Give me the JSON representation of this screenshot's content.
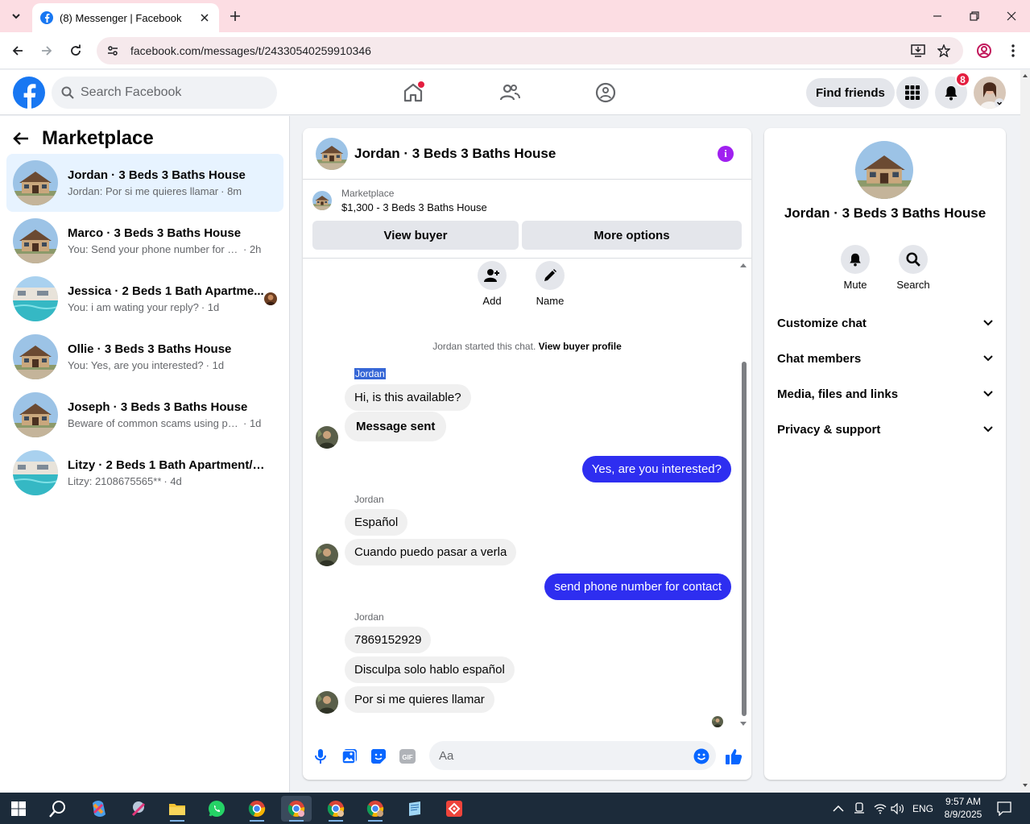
{
  "browser": {
    "tab_title": "(8) Messenger | Facebook",
    "url": "facebook.com/messages/t/24330540259910346"
  },
  "fbnav": {
    "search_placeholder": "Search Facebook",
    "find_friends": "Find friends",
    "notification_count": "8"
  },
  "left": {
    "title": "Marketplace",
    "conversations": [
      {
        "name": "Jordan · 3 Beds 3 Baths House",
        "preview": "Jordan: Por si me quieres llamar",
        "time": "· 8m",
        "active": true,
        "thumb": "house"
      },
      {
        "name": "Marco · 3 Beds 3 Baths House",
        "preview": "You: Send your phone number for co...",
        "time": "· 2h",
        "thumb": "house"
      },
      {
        "name": "Jessica · 2 Beds 1 Bath Apartme...",
        "preview": "You: i am wating your reply?",
        "time": "· 1d",
        "thumb": "pool"
      },
      {
        "name": "Ollie · 3 Beds 3 Baths House",
        "preview": "You: Yes, are you interested?",
        "time": "· 1d",
        "thumb": "house"
      },
      {
        "name": "Joseph · 3 Beds 3 Baths House",
        "preview": "Beware of common scams using pay...",
        "time": "· 1d",
        "thumb": "house"
      },
      {
        "name": "Litzy · 2 Beds 1 Bath Apartment/co...",
        "preview": "Litzy: 2108675565**",
        "time": "· 4d",
        "thumb": "pool"
      }
    ]
  },
  "chat": {
    "title": "Jordan · 3 Beds 3 Baths House",
    "marketplace_label": "Marketplace",
    "listing": "$1,300 - 3 Beds 3 Baths House",
    "view_buyer": "View buyer",
    "more_options": "More options",
    "add_label": "Add",
    "name_label": "Name",
    "system_text": "Jordan started this chat.",
    "system_link": "View buyer profile",
    "sender1": "Jordan",
    "m1": "Hi, is this available?",
    "m2": "Message sent",
    "out1": "Yes, are you interested?",
    "sender2": "Jordan",
    "m3": "Español",
    "m4": "Cuando puedo pasar a verla",
    "out2": "send phone number for contact",
    "sender3": "Jordan",
    "m5": "7869152929",
    "m6": "Disculpa solo hablo español",
    "m7": "Por si me quieres llamar",
    "input_placeholder": "Aa"
  },
  "right": {
    "name": "Jordan · 3 Beds 3 Baths House",
    "mute": "Mute",
    "search": "Search",
    "sections": [
      "Customize chat",
      "Chat members",
      "Media, files and links",
      "Privacy & support"
    ]
  },
  "taskbar": {
    "lang": "ENG",
    "time": "9:57 AM",
    "date": "8/9/2025"
  },
  "colors": {
    "fb_blue": "#1877f2",
    "outgoing_bubble": "#2e2ef0",
    "info_purple": "#a020f0",
    "badge_red": "#e41e3f"
  }
}
